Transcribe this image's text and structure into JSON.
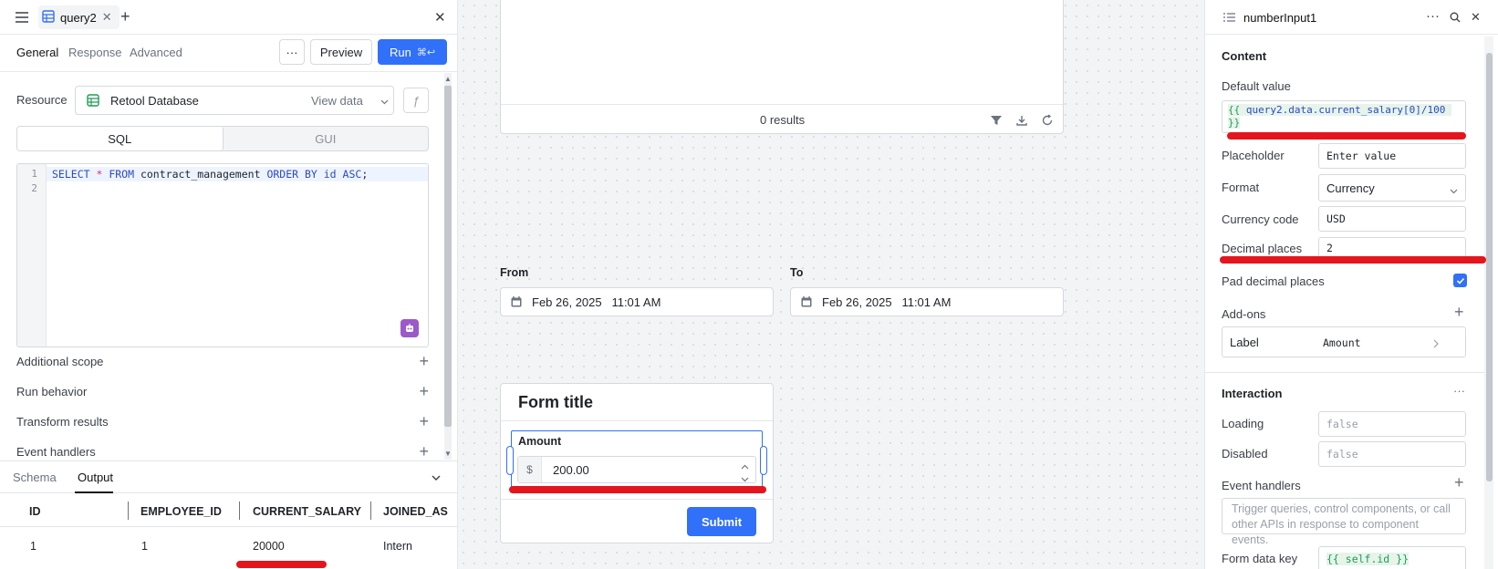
{
  "query_panel": {
    "tab_name": "query2",
    "subtabs": [
      "General",
      "Response",
      "Advanced"
    ],
    "more_label": "···",
    "preview_label": "Preview",
    "run_label": "Run",
    "run_shortcut": "⌘↩",
    "resource_label": "Resource",
    "resource_value": "Retool Database",
    "view_data_label": "View data",
    "fx_label": "ƒ",
    "mode_tabs": [
      "SQL",
      "GUI"
    ],
    "code_lines": [
      {
        "n": "1",
        "tokens": [
          [
            "kw",
            "SELECT "
          ],
          [
            "op",
            "* "
          ],
          [
            "kw",
            "FROM "
          ],
          [
            "",
            "contract_management "
          ],
          [
            "kw",
            "ORDER BY "
          ],
          [
            "kw",
            "id "
          ],
          [
            "kw",
            "ASC"
          ],
          [
            "",
            ";"
          ]
        ]
      },
      {
        "n": "2",
        "tokens": []
      }
    ],
    "sections": [
      "Additional scope",
      "Run behavior",
      "Transform results",
      "Event handlers"
    ],
    "output_tabs": [
      "Schema",
      "Output"
    ],
    "table": {
      "columns": [
        "ID",
        "EMPLOYEE_ID",
        "CURRENT_SALARY",
        "JOINED_AS"
      ],
      "rows": [
        [
          "1",
          "1",
          "20000",
          "Intern"
        ]
      ]
    }
  },
  "canvas": {
    "results_text": "0 results",
    "from_label": "From",
    "to_label": "To",
    "from_value": "Feb 26, 2025   11:01 AM",
    "to_value": "Feb 26, 2025   11:01 AM",
    "form": {
      "title": "Form title",
      "amount_label": "Amount",
      "currency_symbol": "$",
      "amount_value": "200.00",
      "submit_label": "Submit"
    }
  },
  "inspector": {
    "component_name": "numberInput1",
    "content_title": "Content",
    "default_value_label": "Default value",
    "default_value_expr_open": "{{",
    "default_value_expr_body": " query2.data.current_salary[0]/100 ",
    "default_value_expr_close": "}}",
    "placeholder_label": "Placeholder",
    "placeholder_value": "Enter value",
    "format_label": "Format",
    "format_value": "Currency",
    "currency_code_label": "Currency code",
    "currency_code_value": "USD",
    "decimal_places_label": "Decimal places",
    "decimal_places_value": "2",
    "pad_decimal_label": "Pad decimal places",
    "pad_decimal_checked": true,
    "addons_label": "Add-ons",
    "addon_label_key": "Label",
    "addon_label_value": "Amount",
    "interaction_title": "Interaction",
    "loading_label": "Loading",
    "loading_value": "false",
    "disabled_label": "Disabled",
    "disabled_value": "false",
    "event_handlers_label": "Event handlers",
    "event_handlers_hint": "Trigger queries, control components, or call other APIs in response to component events.",
    "form_data_key_label": "Form data key",
    "form_data_key_value": "{{ self.id }}"
  },
  "colors": {
    "accent": "#3170f9",
    "annotation_red": "#e5151d",
    "canvas_bg": "#f3f4f6"
  }
}
